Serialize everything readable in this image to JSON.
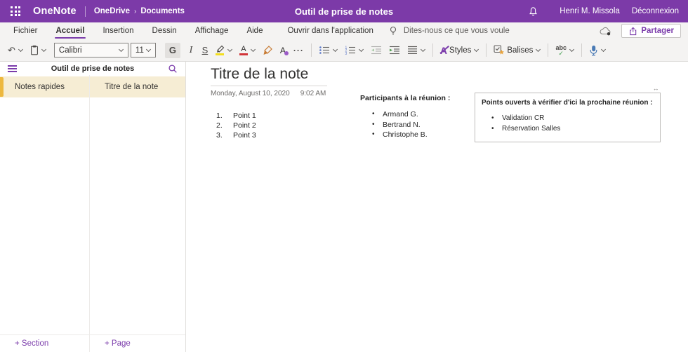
{
  "colors": {
    "brand_purple": "#7c3aa8",
    "accent_purple": "#7b3cab",
    "selection_cream": "#f6edd4",
    "selection_gold": "#edb83e",
    "font_color_red": "#d13438",
    "highlight_yellow": "#f3de1f"
  },
  "icons": {
    "undo": "↶",
    "more": "···"
  },
  "topbar": {
    "app_name": "OneNote",
    "breadcrumb": {
      "root": "OneDrive",
      "separator": "›",
      "current": "Documents"
    },
    "document_title": "Outil de prise de notes",
    "user_name": "Henri M. Missola",
    "sign_out": "Déconnexion"
  },
  "menubar": {
    "tabs": [
      {
        "label": "Fichier"
      },
      {
        "label": "Accueil",
        "active": true
      },
      {
        "label": "Insertion"
      },
      {
        "label": "Dessin"
      },
      {
        "label": "Affichage"
      },
      {
        "label": "Aide"
      }
    ],
    "open_in_app": "Ouvrir dans l'application",
    "tell_me": "Dites-nous ce que vous voule",
    "share": "Partager"
  },
  "ribbon": {
    "font_name": "Calibri",
    "font_size": "11",
    "bold": "G",
    "italic": "I",
    "underline": "S",
    "font_color_letter": "A",
    "text_effects_letter": "A",
    "styles_letter": "A",
    "styles": "Styles",
    "tags": "Balises",
    "spellcheck": "abc",
    "spellcheck_mark": "✓"
  },
  "sidebar": {
    "notebook_title": "Outil de prise de notes",
    "sections": [
      {
        "label": "Notes rapides",
        "selected": true
      }
    ],
    "pages": [
      {
        "label": "Titre de la note",
        "selected": true
      }
    ],
    "add_section": "+ Section",
    "add_page": "+ Page"
  },
  "page": {
    "title": "Titre de la note",
    "date": "Monday, August 10, 2020",
    "time": "9:02 AM",
    "numbered_list": [
      {
        "marker": "1.",
        "text": "Point 1"
      },
      {
        "marker": "2.",
        "text": "Point 2"
      },
      {
        "marker": "3.",
        "text": "Point 3"
      }
    ],
    "participants": {
      "heading": "Participants à la réunion :",
      "items": [
        "Armand G.",
        "Bertrand N.",
        "Christophe B."
      ]
    },
    "open_points": {
      "heading": "Points ouverts à vérifier d'ici la prochaine réunion :",
      "items": [
        "Validation CR",
        "Réservation Salles"
      ],
      "resize_icon": "↔"
    }
  }
}
